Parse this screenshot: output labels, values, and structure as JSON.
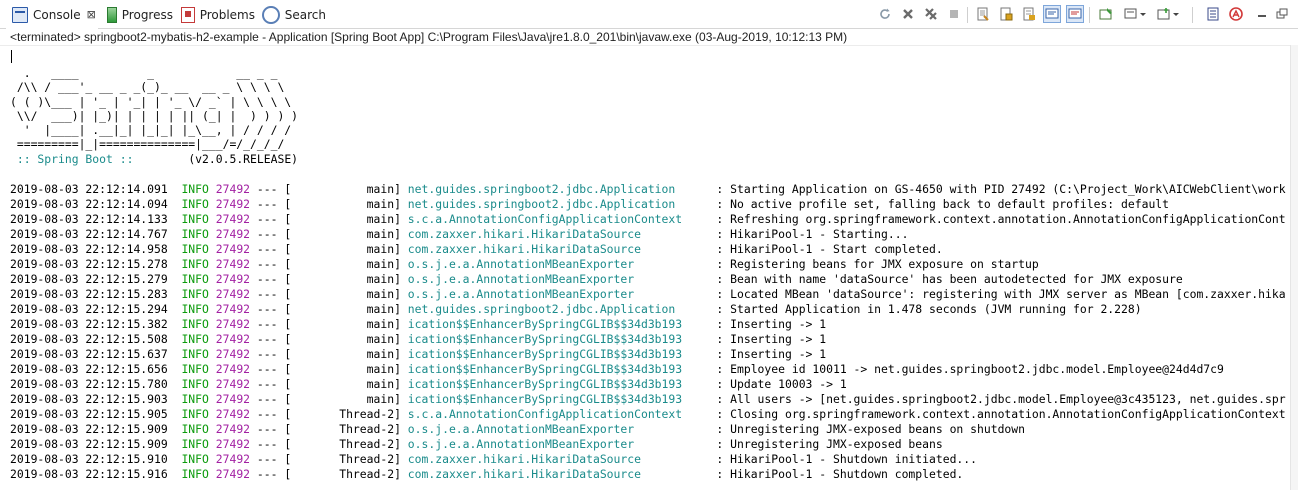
{
  "tabs": [
    {
      "label": "Console",
      "icon": "console-icon",
      "active": true,
      "closable": true
    },
    {
      "label": "Progress",
      "icon": "progress-icon"
    },
    {
      "label": "Problems",
      "icon": "problems-icon"
    },
    {
      "label": "Search",
      "icon": "search-icon"
    }
  ],
  "close_glyph": "⊠",
  "status_line": "<terminated> springboot2-mybatis-h2-example - Application [Spring Boot App] C:\\Program Files\\Java\\jre1.8.0_201\\bin\\javaw.exe (03-Aug-2019, 10:12:13 PM)",
  "banner": "  .   ____          _            __ _ _\n /\\\\ / ___'_ __ _ _(_)_ __  __ _ \\ \\ \\ \\\n( ( )\\___ | '_ | '_| | '_ \\/ _` | \\ \\ \\ \\\n \\\\/  ___)| |_)| | | | | || (_| |  ) ) ) )\n  '  |____| .__|_| |_|_| |_\\__, | / / / /\n =========|_|==============|___/=/_/_/_/",
  "boot": {
    "label": " :: Spring Boot :: ",
    "version": "       (v2.0.5.RELEASE)"
  },
  "log_columns": {
    "separator": " --- ["
  },
  "log_rows": [
    {
      "ts": "2019-08-03 22:12:14.091",
      "level": "INFO",
      "pid": "27492",
      "thread": "           main]",
      "logger": "net.guides.springboot2.jdbc.Application     ",
      "msg": ": Starting Application on GS-4650 with PID 27492 (C:\\Project_Work\\AICWebClient\\work"
    },
    {
      "ts": "2019-08-03 22:12:14.094",
      "level": "INFO",
      "pid": "27492",
      "thread": "           main]",
      "logger": "net.guides.springboot2.jdbc.Application     ",
      "msg": ": No active profile set, falling back to default profiles: default"
    },
    {
      "ts": "2019-08-03 22:12:14.133",
      "level": "INFO",
      "pid": "27492",
      "thread": "           main]",
      "logger": "s.c.a.AnnotationConfigApplicationContext    ",
      "msg": ": Refreshing org.springframework.context.annotation.AnnotationConfigApplicationCont"
    },
    {
      "ts": "2019-08-03 22:12:14.767",
      "level": "INFO",
      "pid": "27492",
      "thread": "           main]",
      "logger": "com.zaxxer.hikari.HikariDataSource          ",
      "msg": ": HikariPool-1 - Starting..."
    },
    {
      "ts": "2019-08-03 22:12:14.958",
      "level": "INFO",
      "pid": "27492",
      "thread": "           main]",
      "logger": "com.zaxxer.hikari.HikariDataSource          ",
      "msg": ": HikariPool-1 - Start completed."
    },
    {
      "ts": "2019-08-03 22:12:15.278",
      "level": "INFO",
      "pid": "27492",
      "thread": "           main]",
      "logger": "o.s.j.e.a.AnnotationMBeanExporter           ",
      "msg": ": Registering beans for JMX exposure on startup"
    },
    {
      "ts": "2019-08-03 22:12:15.279",
      "level": "INFO",
      "pid": "27492",
      "thread": "           main]",
      "logger": "o.s.j.e.a.AnnotationMBeanExporter           ",
      "msg": ": Bean with name 'dataSource' has been autodetected for JMX exposure"
    },
    {
      "ts": "2019-08-03 22:12:15.283",
      "level": "INFO",
      "pid": "27492",
      "thread": "           main]",
      "logger": "o.s.j.e.a.AnnotationMBeanExporter           ",
      "msg": ": Located MBean 'dataSource': registering with JMX server as MBean [com.zaxxer.hika"
    },
    {
      "ts": "2019-08-03 22:12:15.294",
      "level": "INFO",
      "pid": "27492",
      "thread": "           main]",
      "logger": "net.guides.springboot2.jdbc.Application     ",
      "msg": ": Started Application in 1.478 seconds (JVM running for 2.228)"
    },
    {
      "ts": "2019-08-03 22:12:15.382",
      "level": "INFO",
      "pid": "27492",
      "thread": "           main]",
      "logger": "ication$$EnhancerBySpringCGLIB$$34d3b193    ",
      "msg": ": Inserting -> 1"
    },
    {
      "ts": "2019-08-03 22:12:15.508",
      "level": "INFO",
      "pid": "27492",
      "thread": "           main]",
      "logger": "ication$$EnhancerBySpringCGLIB$$34d3b193    ",
      "msg": ": Inserting -> 1"
    },
    {
      "ts": "2019-08-03 22:12:15.637",
      "level": "INFO",
      "pid": "27492",
      "thread": "           main]",
      "logger": "ication$$EnhancerBySpringCGLIB$$34d3b193    ",
      "msg": ": Inserting -> 1"
    },
    {
      "ts": "2019-08-03 22:12:15.656",
      "level": "INFO",
      "pid": "27492",
      "thread": "           main]",
      "logger": "ication$$EnhancerBySpringCGLIB$$34d3b193    ",
      "msg": ": Employee id 10011 -> net.guides.springboot2.jdbc.model.Employee@24d4d7c9"
    },
    {
      "ts": "2019-08-03 22:12:15.780",
      "level": "INFO",
      "pid": "27492",
      "thread": "           main]",
      "logger": "ication$$EnhancerBySpringCGLIB$$34d3b193    ",
      "msg": ": Update 10003 -> 1"
    },
    {
      "ts": "2019-08-03 22:12:15.903",
      "level": "INFO",
      "pid": "27492",
      "thread": "           main]",
      "logger": "ication$$EnhancerBySpringCGLIB$$34d3b193    ",
      "msg": ": All users -> [net.guides.springboot2.jdbc.model.Employee@3c435123, net.guides.spr"
    },
    {
      "ts": "2019-08-03 22:12:15.905",
      "level": "INFO",
      "pid": "27492",
      "thread": "       Thread-2]",
      "logger": "s.c.a.AnnotationConfigApplicationContext    ",
      "msg": ": Closing org.springframework.context.annotation.AnnotationConfigApplicationContext"
    },
    {
      "ts": "2019-08-03 22:12:15.909",
      "level": "INFO",
      "pid": "27492",
      "thread": "       Thread-2]",
      "logger": "o.s.j.e.a.AnnotationMBeanExporter           ",
      "msg": ": Unregistering JMX-exposed beans on shutdown"
    },
    {
      "ts": "2019-08-03 22:12:15.909",
      "level": "INFO",
      "pid": "27492",
      "thread": "       Thread-2]",
      "logger": "o.s.j.e.a.AnnotationMBeanExporter           ",
      "msg": ": Unregistering JMX-exposed beans"
    },
    {
      "ts": "2019-08-03 22:12:15.910",
      "level": "INFO",
      "pid": "27492",
      "thread": "       Thread-2]",
      "logger": "com.zaxxer.hikari.HikariDataSource          ",
      "msg": ": HikariPool-1 - Shutdown initiated..."
    },
    {
      "ts": "2019-08-03 22:12:15.916",
      "level": "INFO",
      "pid": "27492",
      "thread": "       Thread-2]",
      "logger": "com.zaxxer.hikari.HikariDataSource          ",
      "msg": ": HikariPool-1 - Shutdown completed."
    }
  ],
  "toolbar": [
    {
      "name": "refresh-icon"
    },
    {
      "name": "terminate-icon"
    },
    {
      "name": "remove-all-terminated-icon"
    },
    {
      "name": "stop-icon"
    },
    {
      "name": "clear-console-icon"
    },
    {
      "name": "scroll-lock-icon"
    },
    {
      "name": "word-wrap-icon"
    },
    {
      "name": "show-on-stdout-icon",
      "pressed": true
    },
    {
      "name": "show-on-stderr-icon",
      "pressed": true
    },
    {
      "name": "pin-console-icon"
    },
    {
      "name": "display-selected-console-icon"
    },
    {
      "name": "open-console-icon"
    },
    {
      "name": "view-menu-icon"
    },
    {
      "name": "minimize-icon"
    },
    {
      "name": "maximize-icon"
    }
  ],
  "colors": {
    "info": "#0c9b0c",
    "pid": "#a21fa2",
    "logger": "#1a8b8b",
    "text": "#000000"
  }
}
